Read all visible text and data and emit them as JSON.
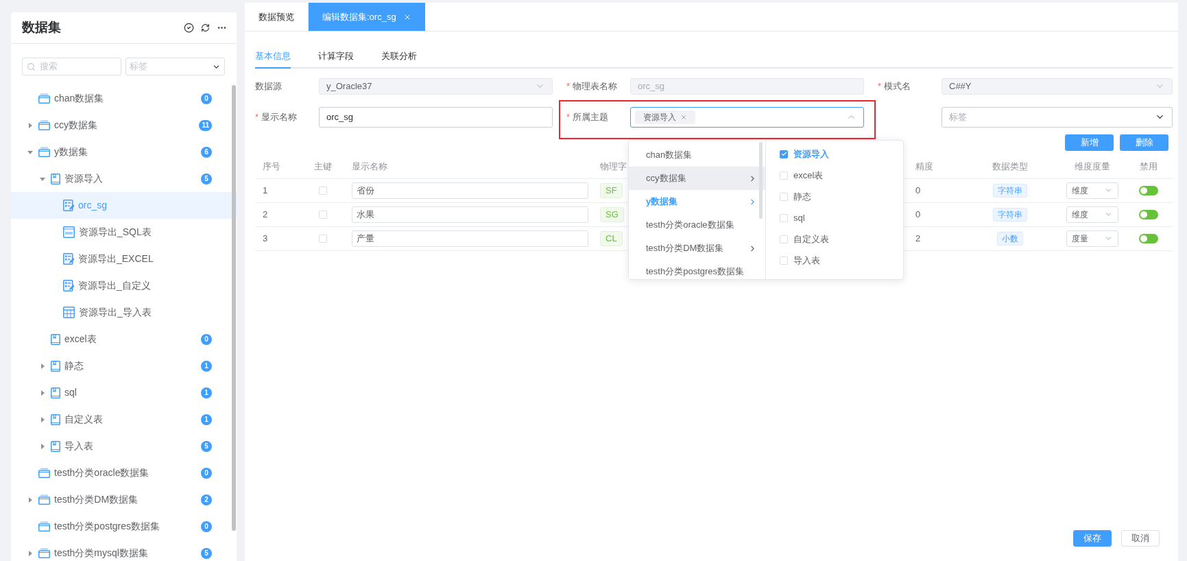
{
  "sidebar": {
    "title": "数据集",
    "search": {
      "placeholder": "搜索"
    },
    "tag_filter": {
      "placeholder": "标签"
    },
    "tree": [
      {
        "label": "chan数据集",
        "kind": "dataset",
        "count": "0",
        "selected": false
      },
      {
        "label": "ccy数据集",
        "kind": "dataset",
        "count": "11",
        "selected": false,
        "expanded": false
      },
      {
        "label": "y数据集",
        "kind": "dataset",
        "count": "6",
        "selected": false,
        "expanded": true,
        "children": [
          {
            "label": "资源导入",
            "kind": "folder",
            "count": "5",
            "selected": false,
            "expanded": true,
            "children": [
              {
                "label": "orc_sg",
                "kind": "form",
                "selected": true
              },
              {
                "label": "资源导出_SQL表",
                "kind": "sql",
                "selected": false
              },
              {
                "label": "资源导出_EXCEL",
                "kind": "form",
                "selected": false
              },
              {
                "label": "资源导出_自定义",
                "kind": "form",
                "selected": false
              },
              {
                "label": "资源导出_导入表",
                "kind": "table",
                "selected": false
              }
            ]
          },
          {
            "label": "excel表",
            "kind": "folder",
            "count": "0",
            "selected": false
          },
          {
            "label": "静态",
            "kind": "folder",
            "count": "1",
            "selected": false,
            "expanded": false
          },
          {
            "label": "sql",
            "kind": "folder",
            "count": "1",
            "selected": false,
            "expanded": false
          },
          {
            "label": "自定义表",
            "kind": "folder",
            "count": "1",
            "selected": false,
            "expanded": false
          },
          {
            "label": "导入表",
            "kind": "folder",
            "count": "5",
            "selected": false,
            "expanded": false
          }
        ]
      },
      {
        "label": "testh分类oracle数据集",
        "kind": "dataset",
        "count": "0",
        "selected": false
      },
      {
        "label": "testh分类DM数据集",
        "kind": "dataset",
        "count": "2",
        "selected": false,
        "expanded": false
      },
      {
        "label": "testh分类postgres数据集",
        "kind": "dataset",
        "count": "0",
        "selected": false
      },
      {
        "label": "testh分类mysql数据集",
        "kind": "dataset",
        "count": "5",
        "selected": false,
        "expanded": false
      }
    ]
  },
  "tabs": [
    {
      "label": "数据预览",
      "selected": false,
      "closable": false
    },
    {
      "label": "编辑数据集:orc_sg",
      "selected": true,
      "closable": true
    }
  ],
  "sub_tabs": [
    {
      "label": "基本信息",
      "selected": true
    },
    {
      "label": "计算字段",
      "selected": false
    },
    {
      "label": "关联分析",
      "selected": false
    }
  ],
  "form": {
    "fields": [
      {
        "label": "数据源",
        "kind": "select",
        "value": "y_Oracle37",
        "disabled": true
      },
      {
        "required_mark": "*",
        "label": "物理表名称",
        "kind": "input",
        "value": "orc_sg",
        "disabled": true
      },
      {
        "required_mark": "*",
        "label": "模式名",
        "kind": "select",
        "value": "C##Y",
        "disabled": true
      },
      {
        "required_mark": "*",
        "label": "显示名称",
        "kind": "input",
        "value": "orc_sg",
        "disabled": false
      },
      {
        "required_mark": "*",
        "label": "所属主题",
        "kind": "multiselect",
        "tags": [
          "资源导入"
        ],
        "expanded": true
      },
      {
        "kind": "select",
        "placeholder": "标签"
      }
    ]
  },
  "theme_dropdown": {
    "categories": [
      {
        "label": "chan数据集",
        "has_children": false,
        "selected": false,
        "hovered": false
      },
      {
        "label": "ccy数据集",
        "has_children": true,
        "selected": false,
        "hovered": true
      },
      {
        "label": "y数据集",
        "has_children": true,
        "selected": true,
        "hovered": false
      },
      {
        "label": "testh分类oracle数据集",
        "has_children": false,
        "selected": false,
        "hovered": false
      },
      {
        "label": "testh分类DM数据集",
        "has_children": true,
        "selected": false,
        "hovered": false
      },
      {
        "label": "testh分类postgres数据集",
        "has_children": false,
        "selected": false,
        "hovered": false
      }
    ],
    "options": [
      {
        "label": "资源导入",
        "checked": true
      },
      {
        "label": "excel表",
        "checked": false
      },
      {
        "label": "静态",
        "checked": false
      },
      {
        "label": "sql",
        "checked": false
      },
      {
        "label": "自定义表",
        "checked": false
      },
      {
        "label": "导入表",
        "checked": false
      }
    ]
  },
  "actions": [
    "新增",
    "删除"
  ],
  "table": {
    "columns": [
      "序号",
      "主键",
      "显示名称",
      "物理字",
      "精度",
      "数据类型",
      "维度度量",
      "禁用"
    ],
    "rows": [
      {
        "index": "1",
        "primary_key": false,
        "display_name": "省份",
        "field": "SF",
        "precision": "0",
        "data_type": "字符串",
        "measure": "维度",
        "disabled_on": true
      },
      {
        "index": "2",
        "primary_key": false,
        "display_name": "水果",
        "field": "SG",
        "precision": "0",
        "data_type": "字符串",
        "measure": "维度",
        "disabled_on": true
      },
      {
        "index": "3",
        "primary_key": false,
        "display_name": "产量",
        "field": "CL",
        "precision": "2",
        "data_type": "小数",
        "measure": "度量",
        "disabled_on": true
      }
    ]
  },
  "footer_buttons": [
    {
      "label": "保存",
      "kind": "primary"
    },
    {
      "label": "取消",
      "kind": "default"
    }
  ]
}
